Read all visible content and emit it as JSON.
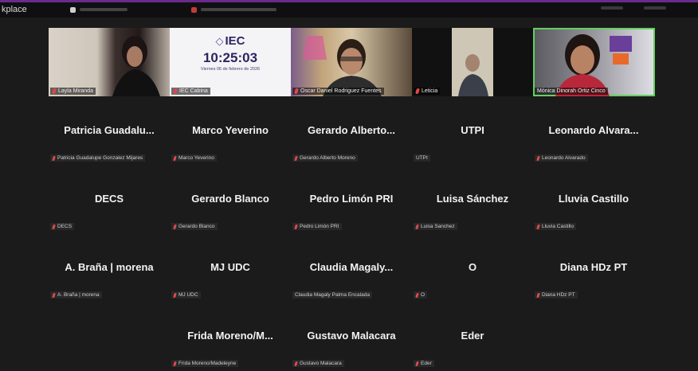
{
  "app": {
    "title": "kplace"
  },
  "tabs": [
    {
      "label": ""
    },
    {
      "label": ""
    }
  ],
  "video_tiles": [
    {
      "name": "Layla Miranda",
      "muted": true
    },
    {
      "name": "IEC Cabina",
      "muted": true,
      "logo": "IEC",
      "clock": "10:25:03",
      "date": "Viernes 06 de febrero de 2026"
    },
    {
      "name": "Oscar Daniel Rodriguez Fuentes",
      "muted": true
    },
    {
      "name": "Leticia",
      "muted": true
    },
    {
      "name": "Mónica Dinorah Ortiz Cinco",
      "muted": false,
      "active": true
    }
  ],
  "participants": [
    {
      "display": "Patricia  Guadalu...",
      "name": "Patricia Guadalupe Gonzalez Mijares",
      "muted": true
    },
    {
      "display": "Marco Yeverino",
      "name": "Marco Yeverino",
      "muted": true
    },
    {
      "display": "Gerardo  Alberto...",
      "name": "Gerardo Alberto Moreno",
      "muted": true
    },
    {
      "display": "UTPI",
      "name": "UTPI",
      "muted": false
    },
    {
      "display": "Leonardo  Alvara...",
      "name": "Leonardo Alvarado",
      "muted": true
    },
    {
      "display": "DECS",
      "name": "DECS",
      "muted": true
    },
    {
      "display": "Gerardo Blanco",
      "name": "Gerardo Blanco",
      "muted": true
    },
    {
      "display": "Pedro Limón PRI",
      "name": "Pedro Limón PRI",
      "muted": true
    },
    {
      "display": "Luisa Sánchez",
      "name": "Luisa Sanchez",
      "muted": true
    },
    {
      "display": "Lluvia Castillo",
      "name": "Lluvia Castillo",
      "muted": true
    },
    {
      "display": "A. Braña | morena",
      "name": "A. Braña | morena",
      "muted": true
    },
    {
      "display": "MJ UDC",
      "name": "MJ UDC",
      "muted": true
    },
    {
      "display": "Claudia  Magaly...",
      "name": "Claudia Magaly Palma Encalada",
      "muted": false
    },
    {
      "display": "O",
      "name": "O",
      "muted": true
    },
    {
      "display": "Diana HDz PT",
      "name": "Diana HDz PT",
      "muted": true
    },
    {
      "display": "Frida Moreno/M...",
      "name": "Frida Moreno/Madeleyne",
      "muted": true
    },
    {
      "display": "Gustavo Malacara",
      "name": "Gustavo Malacara",
      "muted": true
    },
    {
      "display": "Eder",
      "name": "Eder",
      "muted": true
    }
  ],
  "colors": {
    "background": "#1b1b1b",
    "active_speaker": "#5fd35f",
    "muted_icon": "#e04848",
    "titlebar_accent": "#6a2a8c"
  }
}
